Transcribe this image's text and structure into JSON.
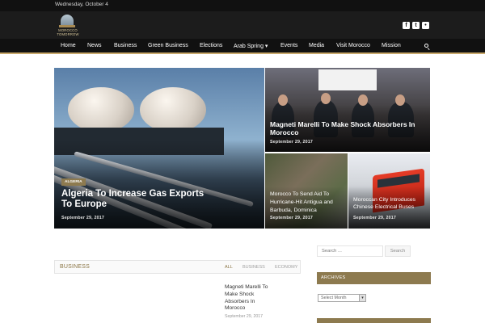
{
  "topbar": {
    "date": "Wednesday, October 4"
  },
  "logo": {
    "text": "MOROCCO TOMORROW"
  },
  "social": {
    "items": [
      "facebook-icon",
      "twitter-icon",
      "flickr-icon"
    ]
  },
  "nav": {
    "items": [
      {
        "label": "Home"
      },
      {
        "label": "News"
      },
      {
        "label": "Business"
      },
      {
        "label": "Green Business"
      },
      {
        "label": "Elections"
      },
      {
        "label": "Arab Spring ▾"
      },
      {
        "label": "Events"
      },
      {
        "label": "Media"
      },
      {
        "label": "Visit Morocco"
      },
      {
        "label": "Mission"
      }
    ]
  },
  "featured": {
    "main": {
      "badge": "ALGERIA",
      "title": "Algeria To Increase Gas Exports To Europe",
      "date": "September 29, 2017"
    },
    "top_right": {
      "title": "Magneti Marelli To Make Shock Absorbers In Morocco",
      "date": "September 29, 2017"
    },
    "bottom_left": {
      "title": "Morocco To Send Aid To Hurricane-Hit Antigua and Barbuda, Dominica",
      "date": "September 29, 2017"
    },
    "bottom_right": {
      "title": "Moroccan City Introduces Chinese Electrical Buses",
      "date": "September 29, 2017"
    }
  },
  "business": {
    "heading": "BUSINESS",
    "tabs": [
      "ALL",
      "BUSINESS",
      "ECONOMY"
    ],
    "post": {
      "title": "Magneti Marelli To Make Shock Absorbers In Morocco",
      "date": "September 29, 2017"
    }
  },
  "sidebar": {
    "search_placeholder": "Search ...",
    "search_button": "Search",
    "archives_heading": "ARCHIVES",
    "archives_select": "Select Month"
  }
}
